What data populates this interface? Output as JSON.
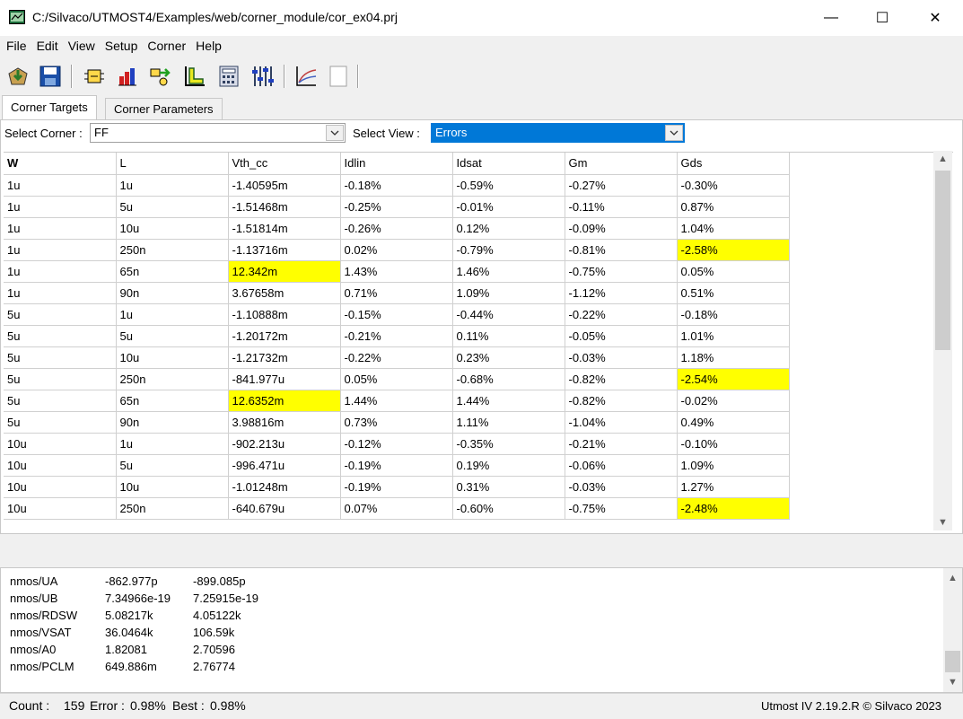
{
  "window": {
    "title": "C:/Silvaco/UTMOST4/Examples/web/corner_module/cor_ex04.prj",
    "minimize": "—",
    "maximize": "☐",
    "close": "✕"
  },
  "menu": [
    "File",
    "Edit",
    "View",
    "Setup",
    "Corner",
    "Help"
  ],
  "toolbar": {
    "icons": [
      "open-project-icon",
      "save-icon",
      "module-icon",
      "bar-chart-icon",
      "arrow-transfer-icon",
      "l-shape-plot-icon",
      "calculator-icon",
      "sliders-icon",
      "curve-plot-icon",
      "blank-page-icon"
    ]
  },
  "tabs": {
    "active": "Corner Targets",
    "inactive": "Corner Parameters"
  },
  "select_corner": {
    "label": "Select Corner :",
    "value": "FF"
  },
  "select_view": {
    "label": "Select View :",
    "value": "Errors"
  },
  "grid": {
    "columns": [
      "W",
      "L",
      "Vth_cc",
      "Idlin",
      "Idsat",
      "Gm",
      "Gds"
    ],
    "rows": [
      [
        "1u",
        "1u",
        "-1.40595m",
        "-0.18%",
        "-0.59%",
        "-0.27%",
        "-0.30%"
      ],
      [
        "1u",
        "5u",
        "-1.51468m",
        "-0.25%",
        "-0.01%",
        "-0.11%",
        "0.87%"
      ],
      [
        "1u",
        "10u",
        "-1.51814m",
        "-0.26%",
        "0.12%",
        "-0.09%",
        "1.04%"
      ],
      [
        "1u",
        "250n",
        "-1.13716m",
        "0.02%",
        "-0.79%",
        "-0.81%",
        "-2.58%"
      ],
      [
        "1u",
        "65n",
        "12.342m",
        "1.43%",
        "1.46%",
        "-0.75%",
        "0.05%"
      ],
      [
        "1u",
        "90n",
        "3.67658m",
        "0.71%",
        "1.09%",
        "-1.12%",
        "0.51%"
      ],
      [
        "5u",
        "1u",
        "-1.10888m",
        "-0.15%",
        "-0.44%",
        "-0.22%",
        "-0.18%"
      ],
      [
        "5u",
        "5u",
        "-1.20172m",
        "-0.21%",
        "0.11%",
        "-0.05%",
        "1.01%"
      ],
      [
        "5u",
        "10u",
        "-1.21732m",
        "-0.22%",
        "0.23%",
        "-0.03%",
        "1.18%"
      ],
      [
        "5u",
        "250n",
        "-841.977u",
        "0.05%",
        "-0.68%",
        "-0.82%",
        "-2.54%"
      ],
      [
        "5u",
        "65n",
        "12.6352m",
        "1.44%",
        "1.44%",
        "-0.82%",
        "-0.02%"
      ],
      [
        "5u",
        "90n",
        "3.98816m",
        "0.73%",
        "1.11%",
        "-1.04%",
        "0.49%"
      ],
      [
        "10u",
        "1u",
        "-902.213u",
        "-0.12%",
        "-0.35%",
        "-0.21%",
        "-0.10%"
      ],
      [
        "10u",
        "5u",
        "-996.471u",
        "-0.19%",
        "0.19%",
        "-0.06%",
        "1.09%"
      ],
      [
        "10u",
        "10u",
        "-1.01248m",
        "-0.19%",
        "0.31%",
        "-0.03%",
        "1.27%"
      ],
      [
        "10u",
        "250n",
        "-640.679u",
        "0.07%",
        "-0.60%",
        "-0.75%",
        "-2.48%"
      ]
    ],
    "highlight_color": "#ffff00",
    "highlighted_cells": [
      [
        3,
        6
      ],
      [
        4,
        2
      ],
      [
        9,
        6
      ],
      [
        10,
        2
      ],
      [
        15,
        6
      ]
    ]
  },
  "log": {
    "rows": [
      [
        "nmos/UA",
        "-862.977p",
        "-899.085p"
      ],
      [
        "nmos/UB",
        "7.34966e-19",
        "7.25915e-19"
      ],
      [
        "nmos/RDSW",
        "5.08217k",
        "4.05122k"
      ],
      [
        "nmos/VSAT",
        "36.0464k",
        "106.59k"
      ],
      [
        "nmos/A0",
        "1.82081",
        "2.70596"
      ],
      [
        "nmos/PCLM",
        "649.886m",
        "2.76774"
      ]
    ]
  },
  "status": {
    "count_label": "Count :",
    "count": "159",
    "error_label": "Error :",
    "error": "0.98%",
    "best_label": "Best :",
    "best": "0.98%",
    "version": "Utmost IV 2.19.2.R © Silvaco 2023"
  }
}
